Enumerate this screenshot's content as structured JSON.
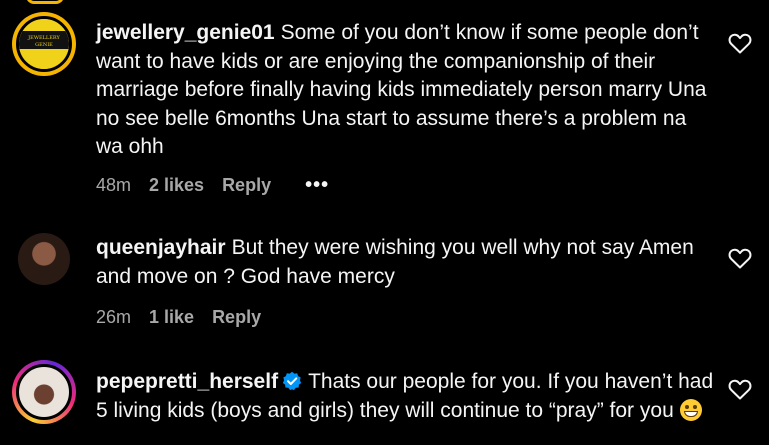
{
  "comments": [
    {
      "username": "jewellery_genie01",
      "text": "Some of you don’t know if some people don’t want to have kids or are enjoying the companionship of their marriage before finally having kids immediately person marry Una no see belle 6months Una start to assume there’s a problem na wa ohh",
      "time": "48m",
      "likes": "2 likes",
      "reply": "Reply",
      "more": "•••",
      "avatar_text": "JEWELLERY GENIE",
      "avatar_colors": {
        "ring": "#f4b400",
        "bg": "#f0d21a",
        "band": "#111111"
      }
    },
    {
      "username": "queenjayhair",
      "text": "But they were wishing you well why not say Amen and move on ? God have mercy",
      "time": "26m",
      "likes": "1 like",
      "reply": "Reply"
    },
    {
      "username": "pepepretti_herself",
      "text": "Thats our people for you. If you haven’t had 5 living kids (boys and girls) they will continue to “pray” for you",
      "verified": true
    }
  ],
  "colors": {
    "background": "#000000",
    "text": "#f5f5f5",
    "muted": "#a8a8a8",
    "verified": "#0095f6"
  },
  "icons": {
    "like": "heart-icon",
    "verified": "verified-badge-icon",
    "more": "more-options-icon"
  }
}
